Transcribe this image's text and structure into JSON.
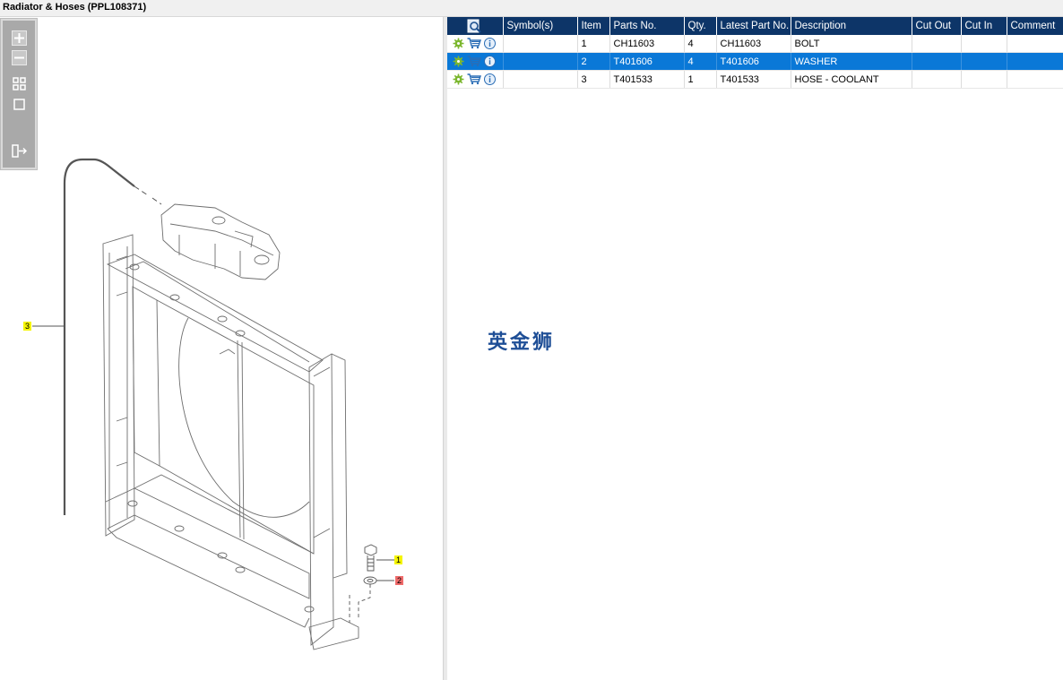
{
  "window": {
    "title": "Radiator & Hoses (PPL108371)"
  },
  "toolbar": {
    "buttons": [
      {
        "name": "zoom-in-icon"
      },
      {
        "name": "zoom-out-icon"
      },
      {
        "name": "fit-all-icon"
      },
      {
        "name": "actual-size-icon"
      },
      {
        "name": "export-icon"
      }
    ]
  },
  "diagram": {
    "callouts": [
      {
        "label": "3",
        "color": "#f5f500"
      },
      {
        "label": "1",
        "color": "#f5f500"
      },
      {
        "label": "2",
        "color": "#ef6b6b"
      }
    ]
  },
  "grid": {
    "headers": [
      "Symbol(s)",
      "Item",
      "Parts No.",
      "Qty.",
      "Latest Part No.",
      "Description",
      "Cut Out",
      "Cut In",
      "Comment"
    ],
    "rows": [
      {
        "symbols": "",
        "item": "1",
        "part_no": "CH11603",
        "qty": "4",
        "latest_part_no": "CH11603",
        "description": "BOLT",
        "cut_out": "",
        "cut_in": "",
        "comment": "",
        "selected": false
      },
      {
        "symbols": "",
        "item": "2",
        "part_no": "T401606",
        "qty": "4",
        "latest_part_no": "T401606",
        "description": "WASHER",
        "cut_out": "",
        "cut_in": "",
        "comment": "",
        "selected": true
      },
      {
        "symbols": "",
        "item": "3",
        "part_no": "T401533",
        "qty": "1",
        "latest_part_no": "T401533",
        "description": "HOSE - COOLANT",
        "cut_out": "",
        "cut_in": "",
        "comment": "",
        "selected": false
      }
    ]
  },
  "watermark": "英金狮",
  "colors": {
    "header_bg": "#0d3568",
    "selected_row": "#0a78d7",
    "watermark": "#1e4e96"
  }
}
